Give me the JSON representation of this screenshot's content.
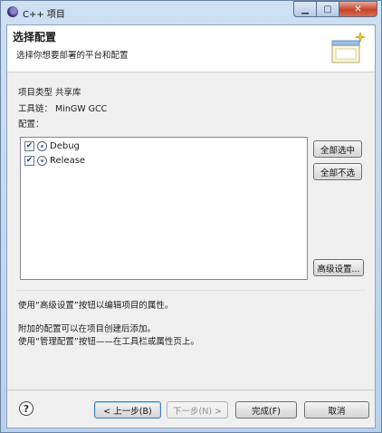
{
  "window": {
    "title": "C++ 项目"
  },
  "header": {
    "title": "选择配置",
    "description": "选择你想要部署的平台和配置"
  },
  "info": {
    "project_type": "项目类型  共享库",
    "toolchain": "工具链：  MinGW GCC",
    "config_label": "配置："
  },
  "configurations": [
    {
      "label": "Debug",
      "checked": true
    },
    {
      "label": "Release",
      "checked": true
    }
  ],
  "side_buttons": {
    "select_all": "全部选中",
    "deselect_all": "全部不选",
    "advanced": "高级设置..."
  },
  "description_lines": [
    "使用“高级设置”按钮以编辑项目的属性。",
    "附加的配置可以在项目创建后添加。",
    "使用“管理配置”按钮——在工具栏或属性页上。"
  ],
  "footer": {
    "back": "< 上一步(B)",
    "next": "下一步(N) >",
    "finish": "完成(F)",
    "cancel": "取消",
    "help_symbol": "?"
  },
  "icons": {
    "app": "eclipse-icon",
    "wizard": "wizard-banner-icon",
    "config": "configuration-icon",
    "help": "help-icon"
  }
}
